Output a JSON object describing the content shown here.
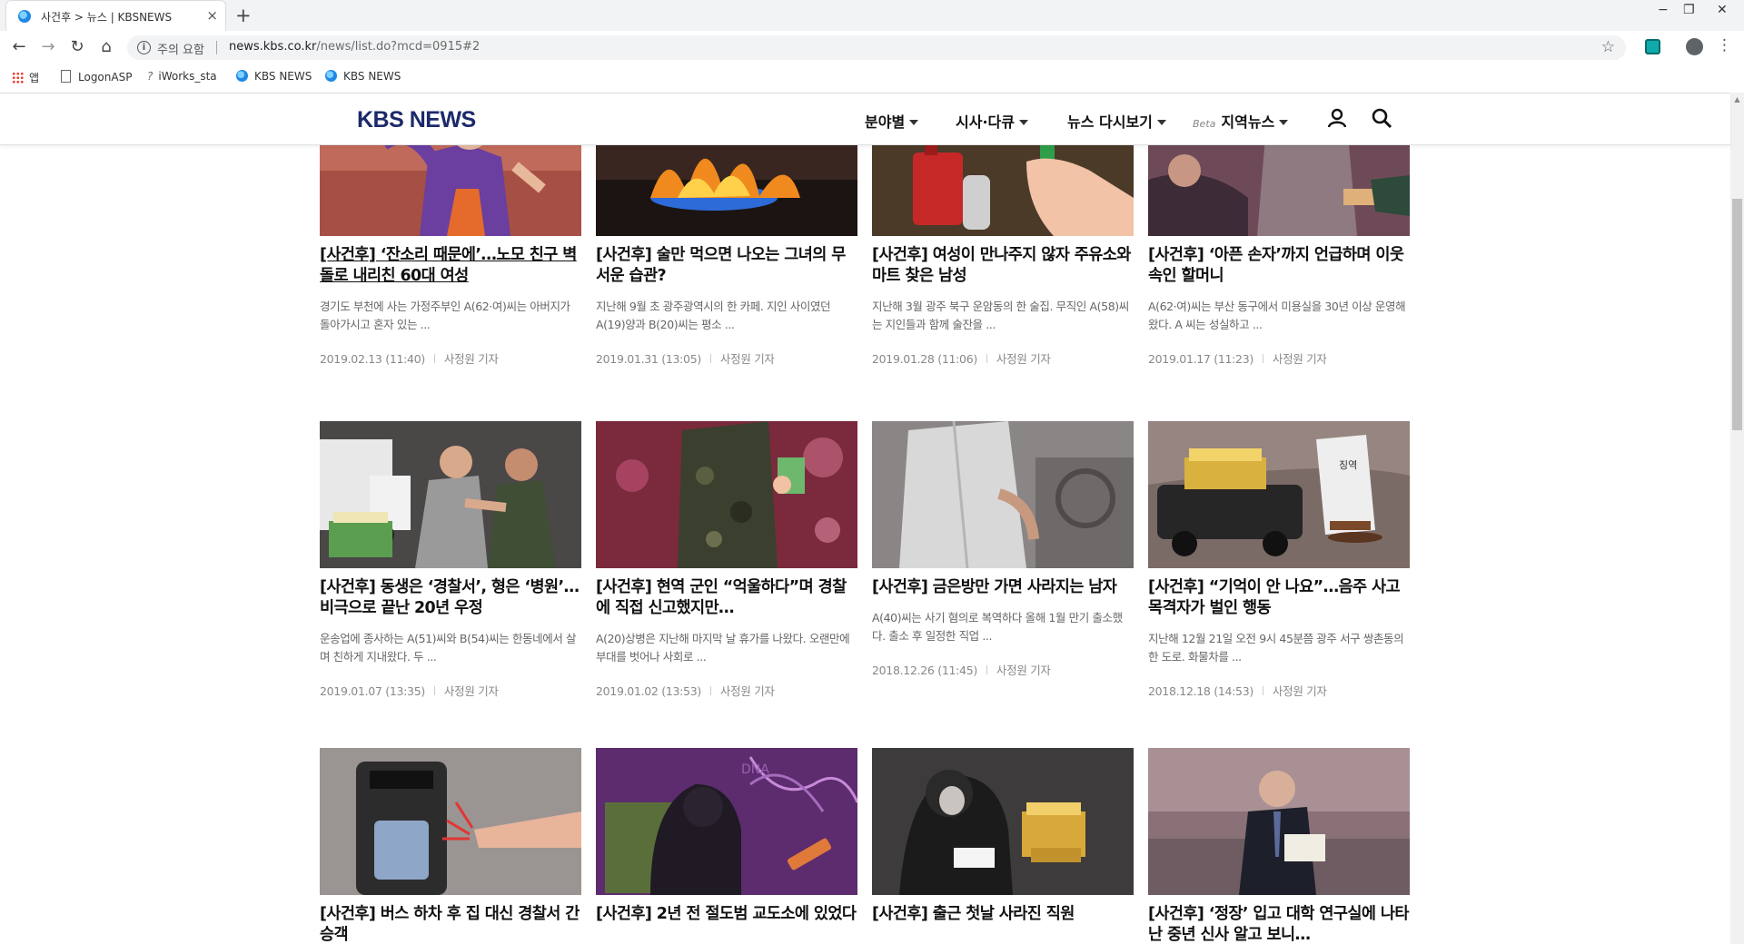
{
  "browser": {
    "tab_title": "사건후 > 뉴스 | KBSNEWS",
    "tab_close": "×",
    "new_tab": "+",
    "window_controls": [
      "−",
      "❐",
      "✕"
    ],
    "address_warning": "주의 요함",
    "url_host": "news.kbs.co.kr",
    "url_path": "/news/list.do?mcd=0915#2",
    "bookmarks": [
      {
        "label": "앱",
        "icon": "apps-icon"
      },
      {
        "label": "LogonASP",
        "icon": "page-icon"
      },
      {
        "label": "iWorks_sta",
        "icon": "leaf-icon"
      },
      {
        "label": "KBS NEWS",
        "icon": "kbs-icon"
      },
      {
        "label": "KBS NEWS",
        "icon": "kbs-icon"
      }
    ]
  },
  "site": {
    "logo": "KBS NEWS",
    "nav": [
      {
        "label": "분야별"
      },
      {
        "label": "시사·다큐"
      },
      {
        "label": "뉴스 다시보기"
      },
      {
        "label": "지역뉴스",
        "badge": "Beta"
      }
    ],
    "icons": [
      "user-icon",
      "search-icon"
    ]
  },
  "articles": [
    {
      "title": "[사건후] ‘잔소리 때문에’…노모 친구 벽돌로 내리친 60대 여성",
      "summary": "경기도 부천에 사는 가정주부인 A(62·여)씨는 아버지가 돌아가시고 혼자 있는 ...",
      "date": "2019.02.13 (11:40)",
      "reporter": "사정원 기자",
      "thumb": "woman-anger"
    },
    {
      "title": "[사건후] 술만 먹으면 나오는 그녀의 무서운 습관?",
      "summary": "지난해 9월 초 광주광역시의 한 카페. 지인 사이였던 A(19)양과 B(20)씨는 평소 ...",
      "date": "2019.01.31 (13:05)",
      "reporter": "사정원 기자",
      "thumb": "gas-fire"
    },
    {
      "title": "[사건후] 여성이 만나주지 않자 주유소와 마트 찾은 남성",
      "summary": "지난해 3월 광주 북구 운암동의 한 술집. 무직인 A(58)씨는 지인들과 함께 술잔을 ...",
      "date": "2019.01.28 (11:06)",
      "reporter": "사정원 기자",
      "thumb": "fuel-lighter"
    },
    {
      "title": "[사건후] ‘아픈 손자’까지 언급하며 이웃 속인 할머니",
      "summary": "A(62·여)씨는 부산 동구에서 미용실을 30년 이상 운영해왔다. A 씨는 성실하고 ...",
      "date": "2019.01.17 (11:23)",
      "reporter": "사정원 기자",
      "thumb": "grandma"
    },
    {
      "title": "[사건후] 동생은 ‘경찰서’, 형은 ‘병원’…비극으로 끝난 20년 우정",
      "summary": "운송업에 종사하는 A(51)씨와 B(54)씨는 한동네에서 살며 친하게 지내왔다. 두 ...",
      "date": "2019.01.07 (13:35)",
      "reporter": "사정원 기자",
      "thumb": "truck-fight"
    },
    {
      "title": "[사건후] 현역 군인 “억울하다”며 경찰에 직접 신고했지만…",
      "summary": "A(20)상병은 지난해 마지막 날 휴가를 나왔다. 오랜만에 부대를 벗어나 사회로 ...",
      "date": "2019.01.02 (13:53)",
      "reporter": "사정원 기자",
      "thumb": "soldier"
    },
    {
      "title": "[사건후] 금은방만 가면 사라지는 남자",
      "summary": "A(40)씨는 사기 혐의로 복역하다 올해 1월 만기 출소했다. 출소 후 일정한 직업 ...",
      "date": "2018.12.26 (11:45)",
      "reporter": "사정원 기자",
      "thumb": "jewelry"
    },
    {
      "title": "[사건후] “기억이 안 나요”…음주 사고 목격자가 벌인 행동",
      "summary": "지난해 12월 21일 오전 9시 45분쯤 광주 서구 쌍촌동의 한 도로. 화물차를 ...",
      "date": "2018.12.18 (14:53)",
      "reporter": "사정원 기자",
      "thumb": "truck-money",
      "thumb_text": "징역"
    },
    {
      "title": "[사건후] 버스 하차 후 집 대신 경찰서 간 승객",
      "summary": "",
      "date": "",
      "reporter": "",
      "thumb": "bus-card"
    },
    {
      "title": "[사건후] 2년 전 절도범 교도소에 있었다",
      "summary": "",
      "date": "",
      "reporter": "",
      "thumb": "dna-thief",
      "thumb_text": "DNA"
    },
    {
      "title": "[사건후] 출근 첫날 사라진 직원",
      "summary": "",
      "date": "",
      "reporter": "",
      "thumb": "hooded-money"
    },
    {
      "title": "[사건후] ‘정장’ 입고 대학 연구실에 나타난 중년 신사 알고 보니…",
      "summary": "",
      "date": "",
      "reporter": "",
      "thumb": "suit-man"
    }
  ]
}
